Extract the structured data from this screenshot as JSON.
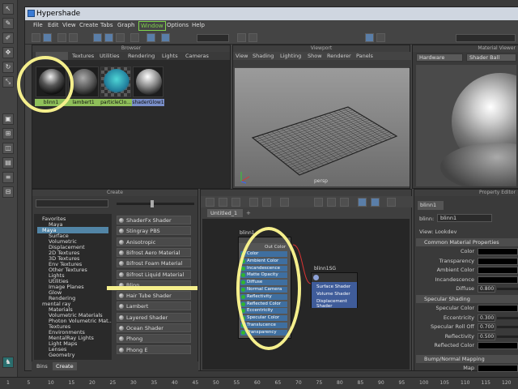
{
  "window": {
    "title": "Hypershade",
    "menus": [
      "File",
      "Edit",
      "View",
      "Create",
      "Tabs",
      "Graph",
      "Window",
      "Options",
      "Help"
    ],
    "active_menu": "Window"
  },
  "browser": {
    "panel_title": "Browser",
    "tabs": [
      "Textures",
      "Utilities",
      "Rendering",
      "Lights",
      "Cameras"
    ],
    "swatches": [
      {
        "label": "blinn1"
      },
      {
        "label": "lambert1"
      },
      {
        "label": "particleClo..."
      },
      {
        "label": "shaderGlow1"
      }
    ]
  },
  "viewport": {
    "panel_title": "Viewport",
    "menus": [
      "View",
      "Shading",
      "Lighting",
      "Show",
      "Renderer",
      "Panels"
    ],
    "camera_label": "persp"
  },
  "material_viewer": {
    "panel_title": "Material Viewer",
    "renderer": "Hardware",
    "preview": "Shader Ball"
  },
  "create": {
    "panel_title": "Create",
    "tree": [
      {
        "label": "Favorites",
        "level": 0
      },
      {
        "label": "Maya",
        "level": 1
      },
      {
        "label": "Maya",
        "level": 0,
        "selected": true
      },
      {
        "label": "Surface",
        "level": 1
      },
      {
        "label": "Volumetric",
        "level": 1
      },
      {
        "label": "Displacement",
        "level": 1
      },
      {
        "label": "2D Textures",
        "level": 1
      },
      {
        "label": "3D Textures",
        "level": 1
      },
      {
        "label": "Env Textures",
        "level": 1
      },
      {
        "label": "Other Textures",
        "level": 1
      },
      {
        "label": "Lights",
        "level": 1
      },
      {
        "label": "Utilities",
        "level": 1
      },
      {
        "label": "Image Planes",
        "level": 1
      },
      {
        "label": "Glow",
        "level": 1
      },
      {
        "label": "Rendering",
        "level": 1
      },
      {
        "label": "mental ray",
        "level": 0
      },
      {
        "label": "Materials",
        "level": 1
      },
      {
        "label": "Volumetric Materials",
        "level": 1
      },
      {
        "label": "Photon Volumetric Mat...",
        "level": 1
      },
      {
        "label": "Textures",
        "level": 1
      },
      {
        "label": "Environments",
        "level": 1
      },
      {
        "label": "MentalRay Lights",
        "level": 1
      },
      {
        "label": "Light Maps",
        "level": 1
      },
      {
        "label": "Lenses",
        "level": 1
      },
      {
        "label": "Geometry",
        "level": 1
      }
    ],
    "shaders": [
      "ShaderFx Shader",
      "Stingray PBS",
      "Anisotropic",
      "Bifrost Aero Material",
      "Bifrost Foam Material",
      "Bifrost Liquid Material",
      "Blinn",
      "Hair Tube Shader",
      "Lambert",
      "Layered Shader",
      "Ocean Shader",
      "Phong",
      "Phong E"
    ],
    "bottom_tabs": [
      "Bins",
      "Create"
    ]
  },
  "graph": {
    "tab_label": "Untitled_1",
    "add_tab": "+",
    "blinn_node": {
      "title": "blinn1",
      "out_label": "Out Color",
      "attributes": [
        "Color",
        "Ambient Color",
        "Incandescence",
        "Matte Opacity",
        "Diffuse",
        "Normal Camera",
        "Reflectivity",
        "Reflected Color",
        "Eccentricity",
        "Specular Color",
        "Translucence",
        "Transparency"
      ]
    },
    "sg_node": {
      "title": "blinn1SG",
      "attributes": [
        "Surface Shader",
        "Volume Shader",
        "Displacement Shader"
      ]
    }
  },
  "property_editor": {
    "panel_title": "Property Editor",
    "node_tab": "blinn1",
    "node_label": "blinn:",
    "node_value": "blinn1",
    "view_label": "View: Lookdev",
    "sections": {
      "common": "Common Material Properties",
      "specular": "Specular Shading",
      "bump": "Bump/Normal Mapping"
    },
    "common_rows": [
      {
        "label": "Color"
      },
      {
        "label": "Transparency"
      },
      {
        "label": "Ambient Color"
      },
      {
        "label": "Incandescence"
      },
      {
        "label": "Diffuse",
        "value": "0.800"
      }
    ],
    "specular_rows": [
      {
        "label": "Specular Color"
      },
      {
        "label": "Eccentricity",
        "value": "0.300"
      },
      {
        "label": "Specular Roll Off",
        "value": "0.700"
      },
      {
        "label": "Reflectivity",
        "value": "0.500"
      },
      {
        "label": "Reflected Color"
      }
    ],
    "bump_rows": [
      {
        "label": "Map"
      }
    ]
  },
  "timeline": {
    "ticks": [
      "1",
      "5",
      "10",
      "15",
      "20",
      "25",
      "30",
      "35",
      "40",
      "45",
      "50",
      "55",
      "60",
      "65",
      "70",
      "75",
      "80",
      "85",
      "90",
      "95",
      "100",
      "105",
      "110",
      "115",
      "120"
    ]
  }
}
